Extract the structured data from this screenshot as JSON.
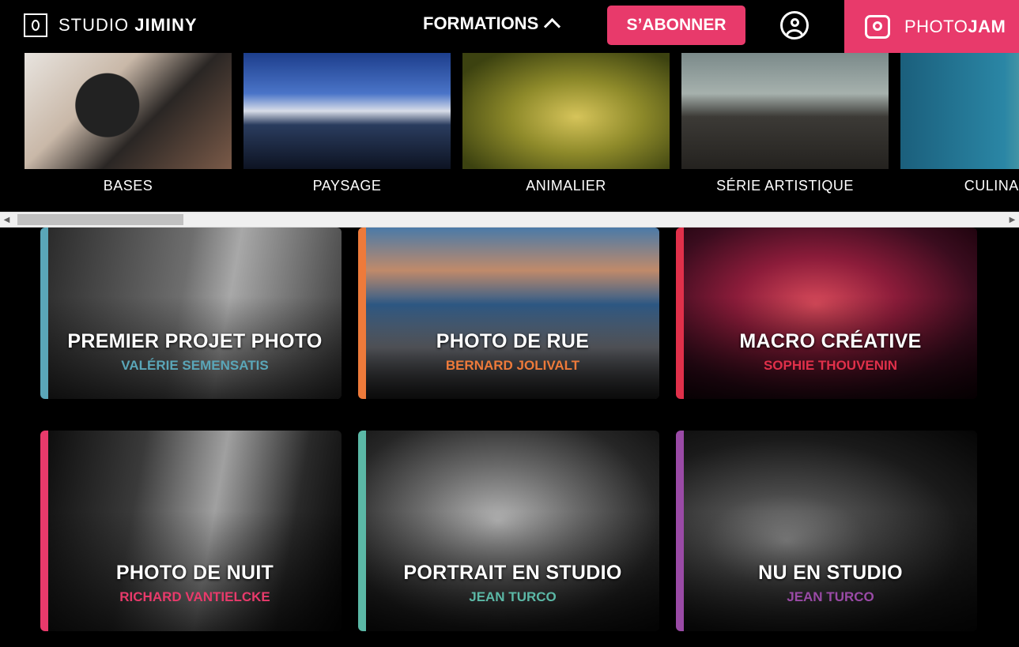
{
  "header": {
    "logo_light": "STUDIO",
    "logo_bold": "JIMINY",
    "nav_formations": "FORMATIONS",
    "subscribe_label": "S’ABONNER",
    "photojam_light": "PHOTO",
    "photojam_bold": "JAM"
  },
  "categories": [
    {
      "label": "BASES"
    },
    {
      "label": "PAYSAGE"
    },
    {
      "label": "ANIMALIER"
    },
    {
      "label": "SÉRIE ARTISTIQUE"
    },
    {
      "label": "CULINAIRE"
    }
  ],
  "courses": [
    {
      "title": "PREMIER PROJET PHOTO",
      "author": "VALÉRIE SEMENSATIS",
      "accent": "#5aa6b8"
    },
    {
      "title": "PHOTO DE RUE",
      "author": "BERNARD JOLIVALT",
      "accent": "#ee7a3a"
    },
    {
      "title": "MACRO CRÉATIVE",
      "author": "SOPHIE THOUVENIN",
      "accent": "#e0304a"
    },
    {
      "title": "PHOTO DE NUIT",
      "author": "RICHARD VANTIELCKE",
      "accent": "#e83a6b"
    },
    {
      "title": "PORTRAIT EN STUDIO",
      "author": "JEAN TURCO",
      "accent": "#5bb8a6"
    },
    {
      "title": "NU EN STUDIO",
      "author": "JEAN TURCO",
      "accent": "#9a4aa6"
    }
  ],
  "colors": {
    "brand_pink": "#e83a6b"
  }
}
